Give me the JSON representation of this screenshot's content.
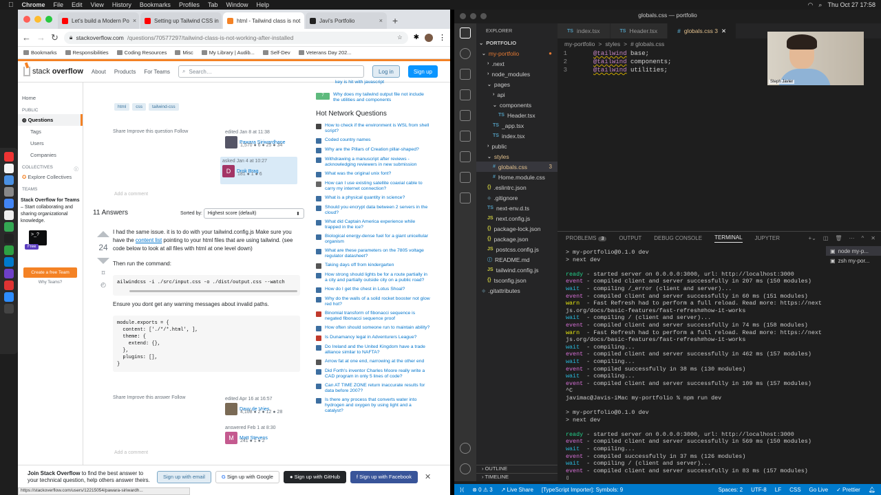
{
  "menubar": {
    "app": "Chrome",
    "items": [
      "File",
      "Edit",
      "View",
      "History",
      "Bookmarks",
      "Profiles",
      "Tab",
      "Window",
      "Help"
    ],
    "datetime": "Thu Oct 27  17:58"
  },
  "colors": {
    "so_orange": "#f48225",
    "so_blue": "#0a95ff",
    "vscode_blue": "#007acc"
  },
  "chrome": {
    "tabs": [
      {
        "title": "Let's build a Modern Po",
        "fav": "#ff0000"
      },
      {
        "title": "Setting up Tailwind CSS in",
        "fav": "#ff0000"
      },
      {
        "title": "html - Tailwind class is not",
        "fav": "#f48225"
      },
      {
        "title": "Javi's Portfolio",
        "fav": "#222"
      }
    ],
    "url_host": "stackoverflow.com",
    "url_path": "/questions/70577297/tailwind-class-is-not-working-after-installed",
    "bookmarks": [
      "Bookmarks",
      "Responsibilities",
      "Coding Resources",
      "Misc",
      "My Library | Audib...",
      "Self-Dev",
      "Veterans Day 202..."
    ]
  },
  "so": {
    "logo_a": "stack",
    "logo_b": "overflow",
    "nav": [
      "About",
      "Products",
      "For Teams"
    ],
    "search_placeholder": "Search…",
    "login": "Log in",
    "signup": "Sign up",
    "left": {
      "home": "Home",
      "public": "PUBLIC",
      "questions": "Questions",
      "tags": "Tags",
      "users": "Users",
      "companies": "Companies",
      "collectives": "COLLECTIVES",
      "explore": "Explore Collectives",
      "teams": "TEAMS",
      "teams_title": "Stack Overflow for Teams",
      "teams_desc": " – Start collaborating and sharing organizational knowledge.",
      "free": "Free",
      "create": "Create a free Team",
      "why": "Why Teams?"
    },
    "question": {
      "tags": [
        "html",
        "css",
        "tailwind-css"
      ],
      "actions": "Share  Improve this question  Follow",
      "edited": "edited Jan 8 at 11:38",
      "editor": "Pawara Siriwardhane",
      "editor_rep": "1,570 ● 6 ● 25 ● 34",
      "asked": "asked Jan 4 at 10:27",
      "asker": "Drok Brag",
      "asker_rep": "181 ● 1 ● 6",
      "comment": "Add a comment"
    },
    "answers": {
      "count": "11 Answers",
      "sorted": "Sorted by:",
      "sort_value": "Highest score (default)",
      "votes": "24",
      "p1a": "I had the same issue. it is to do with your tailwind.config.js Make sure you have the ",
      "p1link": "content list",
      "p1b": " pointing to your html files that are using tailwind. (see code below to look at all files with html at one level down)",
      "p2": "Then run the command:",
      "code1": "ailwindcss -i ./src/input.css -o ./dist/output.css --watch",
      "p3": "Ensure you dont get any warning messages about invalid paths.",
      "code2": "module.exports = {\n  content: ['./*/*.html', ],\n  theme: {\n    extend: {},\n  },\n  plugins: [],\n}",
      "actions": "Share  Improve this answer  Follow",
      "edited": "edited Apr 16 at 16:57",
      "editor": "Davy de Vries",
      "editor_rep": "4,108 ● 2 ● 12 ● 28",
      "answered": "answered Feb 1 at 8:30",
      "answerer": "Matt Stevens",
      "answerer_rep": "241 ● 1 ● 2",
      "comment": "Add a comment"
    },
    "related_top": "key is hit with javascript",
    "related": {
      "count": "7",
      "text": "Why does my tailwind output file not include the utilities and components"
    },
    "hnq_title": "Hot Network Questions",
    "hnq": [
      {
        "t": "How to check if the environment is WSL from shell script?",
        "c": "#444"
      },
      {
        "t": "Coded country names",
        "c": "#3c6ea0"
      },
      {
        "t": "Why are the Pillars of Creation pillar-shaped?",
        "c": "#3c6ea0"
      },
      {
        "t": "Withdrawing a manuscript after reviews - acknowledging reviewers in new submission",
        "c": "#3c6ea0"
      },
      {
        "t": "What was the original unix font?",
        "c": "#3c6ea0"
      },
      {
        "t": "How can I use existing satellite coaxial cable to carry my internet connection?",
        "c": "#666"
      },
      {
        "t": "What is a physical quantity in science?",
        "c": "#3c6ea0"
      },
      {
        "t": "Should you encrypt data between 2 servers in the cloud?",
        "c": "#3c6ea0"
      },
      {
        "t": "What did Captain America experience while trapped in the ice?",
        "c": "#3c6ea0"
      },
      {
        "t": "Biological energy-dense fuel for a giant unicellular organism",
        "c": "#3c6ea0"
      },
      {
        "t": "What are these parameters on the 7805 voltage regulator datasheet?",
        "c": "#3c6ea0"
      },
      {
        "t": "Taking days off from kindergarten",
        "c": "#555"
      },
      {
        "t": "How strong should lights be for a route partially in a city and partially outside city on a public road?",
        "c": "#3c6ea0"
      },
      {
        "t": "How do I get the chest in Lotus Shoal?",
        "c": "#3c6ea0"
      },
      {
        "t": "Why do the walls of a solid rocket booster not glow red hot?",
        "c": "#3c6ea0"
      },
      {
        "t": "Binomial transform of fibonacci sequence is negated fibonacci sequence proof",
        "c": "#c0392b"
      },
      {
        "t": "How often should someone run to maintain ability?",
        "c": "#3c6ea0"
      },
      {
        "t": "Is Dunamancy legal in Adventurers League?",
        "c": "#c0392b"
      },
      {
        "t": "Do Ireland and the United Kingdom have a trade alliance similar to NAFTA?",
        "c": "#3c6ea0"
      },
      {
        "t": "Arrow fat at one end, narrowing at the other end",
        "c": "#555"
      },
      {
        "t": "Did Forth's inventor Charles Moore really write a CAD program in only 5 lines of code?",
        "c": "#3c6ea0"
      },
      {
        "t": "Can AT TIME ZONE return inaccurate results for data before 2007?",
        "c": "#3c6ea0"
      },
      {
        "t": "Is there any process that converts water into hydrogen and oxygen by using light and a catalyst?",
        "c": "#3c6ea0"
      }
    ],
    "join": {
      "title": "Join Stack Overflow",
      "text": " to find the best answer to your technical question, help others answer theirs.",
      "email": "Sign up with email",
      "google": "Sign up with Google",
      "github": "Sign up with GitHub",
      "facebook": "Sign up with Facebook"
    },
    "status_url": "https://stackoverflow.com/users/12215054/pawara-siriwardh..."
  },
  "vscode": {
    "explorer": "EXPLORER",
    "portfolio": "PORTFOLIO",
    "tree": [
      {
        "label": "my-portfolio",
        "indent": 0,
        "kind": "folder-open",
        "color": "#e37933",
        "dot": "●"
      },
      {
        "label": ".next",
        "indent": 1,
        "kind": "folder"
      },
      {
        "label": "node_modules",
        "indent": 1,
        "kind": "folder"
      },
      {
        "label": "pages",
        "indent": 1,
        "kind": "folder-open"
      },
      {
        "label": "api",
        "indent": 2,
        "kind": "folder"
      },
      {
        "label": "components",
        "indent": 2,
        "kind": "folder-open"
      },
      {
        "label": "Header.tsx",
        "indent": 3,
        "kind": "ts"
      },
      {
        "label": "_app.tsx",
        "indent": 2,
        "kind": "ts"
      },
      {
        "label": "index.tsx",
        "indent": 2,
        "kind": "ts"
      },
      {
        "label": "public",
        "indent": 1,
        "kind": "folder"
      },
      {
        "label": "styles",
        "indent": 1,
        "kind": "folder-open",
        "color": "#e2c08d"
      },
      {
        "label": "globals.css",
        "indent": 2,
        "kind": "css",
        "color": "#e2c08d",
        "dot": "3",
        "sel": true
      },
      {
        "label": "Home.module.css",
        "indent": 2,
        "kind": "css"
      },
      {
        "label": ".eslintrc.json",
        "indent": 1,
        "kind": "json"
      },
      {
        "label": ".gitignore",
        "indent": 1,
        "kind": "git"
      },
      {
        "label": "next-env.d.ts",
        "indent": 1,
        "kind": "ts"
      },
      {
        "label": "next.config.js",
        "indent": 1,
        "kind": "js"
      },
      {
        "label": "package-lock.json",
        "indent": 1,
        "kind": "json"
      },
      {
        "label": "package.json",
        "indent": 1,
        "kind": "json"
      },
      {
        "label": "postcss.config.js",
        "indent": 1,
        "kind": "js"
      },
      {
        "label": "README.md",
        "indent": 1,
        "kind": "md"
      },
      {
        "label": "tailwind.config.js",
        "indent": 1,
        "kind": "js"
      },
      {
        "label": "tsconfig.json",
        "indent": 1,
        "kind": "json"
      },
      {
        "label": ".gitattributes",
        "indent": 0,
        "kind": "git"
      }
    ],
    "tabs": [
      {
        "label": "index.tsx",
        "kind": "TS"
      },
      {
        "label": "Header.tsx",
        "kind": "TS"
      },
      {
        "label": "globals.css 3",
        "kind": "#",
        "active": true
      }
    ],
    "breadcrumb": [
      "my-portfolio",
      ">",
      "styles",
      ">",
      "# globals.css"
    ],
    "code": [
      {
        "n": "1",
        "at": "@tailwind",
        "rest": " base;"
      },
      {
        "n": "2",
        "at": "@tailwind",
        "rest": " components;"
      },
      {
        "n": "3",
        "at": "@tailwind",
        "rest": " utilities;"
      }
    ],
    "webcam_name": "Steph Javier",
    "panel": {
      "problems": "PROBLEMS",
      "problems_count": "3",
      "output": "OUTPUT",
      "debug": "DEBUG CONSOLE",
      "terminal": "TERMINAL",
      "jupyter": "JUPYTER"
    },
    "terminals": [
      "node  my-p...",
      "zsh  my-por..."
    ],
    "outline": "OUTLINE",
    "timeline": "TIMELINE",
    "status": {
      "errors": "⊗ 0 ⚠ 3",
      "live": "Live Share",
      "ts": "[TypeScript Importer]: Symbols: 9",
      "spaces": "Spaces: 2",
      "enc": "UTF-8",
      "eol": "LF",
      "lang": "CSS",
      "golive": "Go Live",
      "prettier": "✓ Prettier"
    }
  },
  "terminal_lines": [
    {
      "p": "",
      "t": "> my-portfolio@0.1.0 dev"
    },
    {
      "p": "",
      "t": "> next dev"
    },
    {
      "p": "",
      "t": ""
    },
    {
      "p": "g",
      "t": "ready",
      "r": " - started server on 0.0.0.0:3000, url: http://localhost:3000"
    },
    {
      "p": "m",
      "t": "event",
      "r": " - compiled client and server successfully in 207 ms (150 modules)"
    },
    {
      "p": "c",
      "t": "wait",
      "r": "  - compiling /_error (client and server)..."
    },
    {
      "p": "m",
      "t": "event",
      "r": " - compiled client and server successfully in 60 ms (151 modules)"
    },
    {
      "p": "y",
      "t": "warn",
      "r": "  - Fast Refresh had to perform a full reload. Read more: https://next"
    },
    {
      "p": "",
      "t": "js.org/docs/basic-features/fast-refresh#how-it-works"
    },
    {
      "p": "c",
      "t": "wait",
      "r": "  - compiling / (client and server)..."
    },
    {
      "p": "m",
      "t": "event",
      "r": " - compiled client and server successfully in 74 ms (158 modules)"
    },
    {
      "p": "y",
      "t": "warn",
      "r": "  - Fast Refresh had to perform a full reload. Read more: https://next"
    },
    {
      "p": "",
      "t": "js.org/docs/basic-features/fast-refresh#how-it-works"
    },
    {
      "p": "c",
      "t": "wait",
      "r": "  - compiling..."
    },
    {
      "p": "m",
      "t": "event",
      "r": " - compiled client and server successfully in 462 ms (157 modules)"
    },
    {
      "p": "c",
      "t": "wait",
      "r": "  - compiling..."
    },
    {
      "p": "m",
      "t": "event",
      "r": " - compiled successfully in 38 ms (130 modules)"
    },
    {
      "p": "c",
      "t": "wait",
      "r": "  - compiling..."
    },
    {
      "p": "m",
      "t": "event",
      "r": " - compiled client and server successfully in 109 ms (157 modules)"
    },
    {
      "p": "",
      "t": "^C"
    },
    {
      "p": "",
      "t": "javimac@Javis-iMac my-portfolio % npm run dev"
    },
    {
      "p": "",
      "t": ""
    },
    {
      "p": "",
      "t": "> my-portfolio@0.1.0 dev"
    },
    {
      "p": "",
      "t": "> next dev"
    },
    {
      "p": "",
      "t": ""
    },
    {
      "p": "g",
      "t": "ready",
      "r": " - started server on 0.0.0.0:3000, url: http://localhost:3000"
    },
    {
      "p": "m",
      "t": "event",
      "r": " - compiled client and server successfully in 569 ms (150 modules)"
    },
    {
      "p": "c",
      "t": "wait",
      "r": "  - compiling..."
    },
    {
      "p": "m",
      "t": "event",
      "r": " - compiled successfully in 37 ms (126 modules)"
    },
    {
      "p": "c",
      "t": "wait",
      "r": "  - compiling / (client and server)..."
    },
    {
      "p": "m",
      "t": "event",
      "r": " - compiled client and server successfully in 83 ms (157 modules)"
    },
    {
      "p": "",
      "t": "▯"
    }
  ]
}
